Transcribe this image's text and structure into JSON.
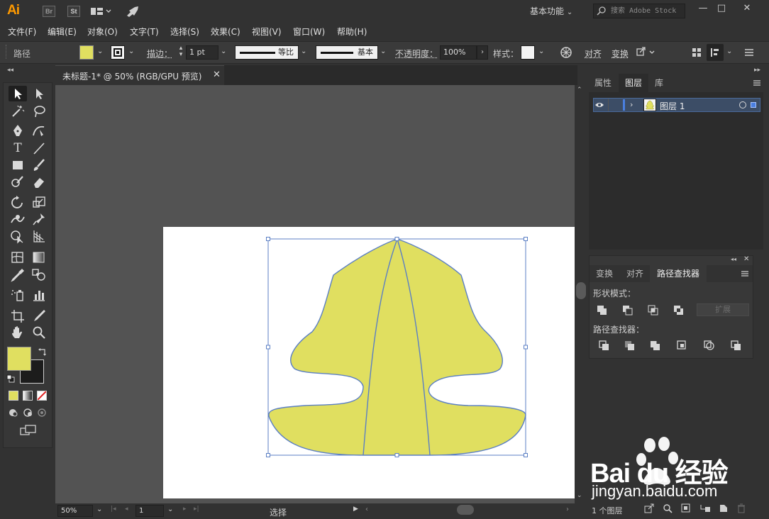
{
  "app": {
    "logo": "Ai",
    "bridge_label": "Br",
    "stock_label": "St",
    "workspace": "基本功能",
    "search_placeholder": "搜索 Adobe Stock",
    "window_controls": [
      "—",
      "□",
      "✕"
    ]
  },
  "menu": [
    "文件(F)",
    "编辑(E)",
    "对象(O)",
    "文字(T)",
    "选择(S)",
    "效果(C)",
    "视图(V)",
    "窗口(W)",
    "帮助(H)"
  ],
  "control": {
    "selection_type": "路径",
    "fill_color": "#e0df60",
    "stroke_label": "描边：",
    "stroke_weight": "1 pt",
    "stroke_profile": "等比",
    "brush": "基本",
    "opacity_label": "不透明度：",
    "opacity_value": "100%",
    "style_label": "样式：",
    "align_label": "对齐",
    "transform_label": "变换"
  },
  "document": {
    "tab_title": "未标题-1* @ 50% (RGB/GPU 预览)",
    "close_glyph": "✕",
    "artwork_fill": "#e0df60",
    "artwork_stroke": "#5b7fc4"
  },
  "status": {
    "zoom": "50%",
    "artboard_number": "1",
    "tool_name": "选择"
  },
  "layers_panel": {
    "tabs": [
      "属性",
      "图层",
      "库"
    ],
    "active_tab": "图层",
    "layers": [
      {
        "name": "图层 1"
      }
    ],
    "footer_count": "1 个图层"
  },
  "pathfinder_panel": {
    "tabs": [
      "变换",
      "对齐",
      "路径查找器"
    ],
    "active_tab": "路径查找器",
    "shape_modes_label": "形状模式：",
    "expand_label": "扩展",
    "pathfinders_label": "路径查找器："
  },
  "watermark": {
    "brand": "Bai du 经验",
    "url": "jingyan.baidu.com"
  },
  "colors": {
    "ui_bg": "#323232",
    "canvas_bg": "#535353",
    "accent_orange": "#ff9a00",
    "selection_blue": "#5b7fc4"
  }
}
